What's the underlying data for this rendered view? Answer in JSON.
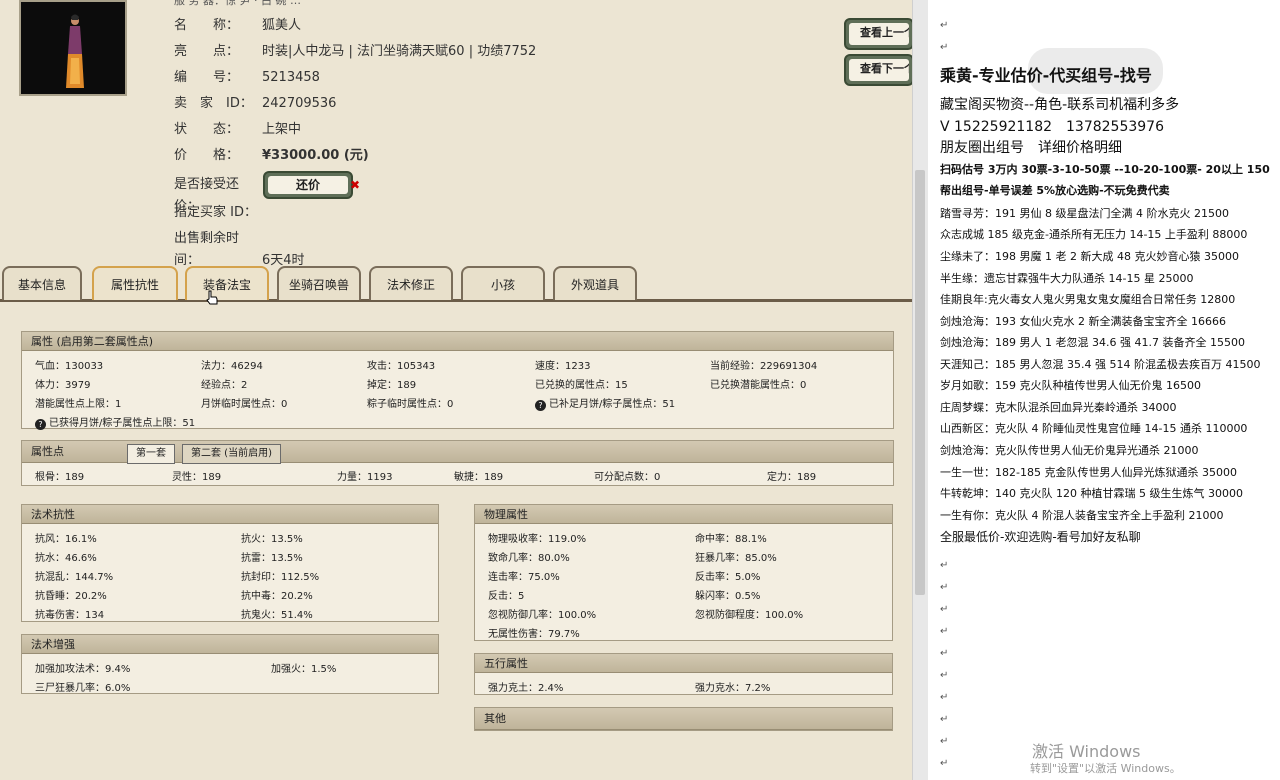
{
  "character": {
    "top_cut_text": "服 务 器：惊 尹 · 白 碗 …",
    "rows": [
      {
        "key": "名　　称：",
        "value": "狐美人"
      },
      {
        "key": "亮　　点：",
        "value": "时装|人中龙马 | 法门坐骑满天赋60 | 功绩7752"
      },
      {
        "key": "编　　号：",
        "value": "5213458"
      },
      {
        "key": "卖　家　ID：",
        "value": "242709536"
      },
      {
        "key": "状　　态：",
        "value": "上架中"
      },
      {
        "key": "价　　格：",
        "value": "¥33000.00 (元)"
      },
      {
        "key": "是否接受还价：",
        "value": ""
      },
      {
        "key": "指定买家 ID：",
        "value": ""
      },
      {
        "key": "出售剩余时间：",
        "value": "6天4时"
      }
    ],
    "bargain_label": "还价",
    "xmark": "✖"
  },
  "nav": {
    "prev_label": "查看上一个",
    "next_label": "查看下一个"
  },
  "tabs": [
    "基本信息",
    "属性抗性",
    "装备法宝",
    "坐骑召唤兽",
    "法术修正",
    "小孩",
    "外观道具"
  ],
  "attributes": {
    "title": "属性 (启用第二套属性点)",
    "rows": [
      [
        "气血：130033",
        "法力：46294",
        "攻击：105343",
        "速度：1233",
        "当前经验：229691304"
      ],
      [
        "体力：3979",
        "经验点：2",
        "掉定：189",
        "已兑换的属性点：15",
        "已兑换潜能属性点：0"
      ],
      [
        "潜能属性点上限：1",
        "月饼临时属性点：0",
        "粽子临时属性点：0",
        "已补足月饼/粽子属性点：51",
        ""
      ]
    ],
    "row3_q": "?",
    "row4": "已获得月饼/粽子属性点上限：51"
  },
  "points": {
    "title": "属性点",
    "tab1": "第一套",
    "tab2": "第二套 (当前启用)",
    "values": [
      "根骨：189",
      "灵性：189",
      "力量：1193",
      "敏捷：189",
      "可分配点数：0",
      "定力：189"
    ]
  },
  "resist": {
    "title": "法术抗性",
    "rows": [
      [
        "抗风：16.1%",
        "抗火：13.5%"
      ],
      [
        "抗水：46.6%",
        "抗雷：13.5%"
      ],
      [
        "抗混乱：144.7%",
        "抗封印：112.5%"
      ],
      [
        "抗昏睡：20.2%",
        "抗中毒：20.2%"
      ],
      [
        "抗毒伤害：134",
        "抗鬼火：51.4%"
      ]
    ]
  },
  "enhance": {
    "title": "法术增强",
    "rows": [
      [
        "加强加攻法术：9.4%",
        "加强火：1.5%"
      ],
      [
        "三尸狂暴几率：6.0%",
        ""
      ]
    ]
  },
  "physical": {
    "title": "物理属性",
    "rows": [
      [
        "物理吸收率：119.0%",
        "命中率：88.1%"
      ],
      [
        "致命几率：80.0%",
        "狂暴几率：85.0%"
      ],
      [
        "连击率：75.0%",
        "反击率：5.0%"
      ],
      [
        "反击：5",
        "躲闪率：0.5%"
      ],
      [
        "忽视防御几率：100.0%",
        "忽视防御程度：100.0%"
      ],
      [
        "无属性伤害：79.7%",
        ""
      ]
    ]
  },
  "wuxing": {
    "title": "五行属性",
    "rows": [
      [
        "强力克土：2.4%",
        "强力克水：7.2%"
      ]
    ]
  },
  "other": {
    "title": "其他"
  },
  "right": {
    "lines": [
      "乘黄-专业估价-代买组号-找号",
      "藏宝阁买物资--角色-联系司机福利多多",
      "V 15225921182　13782553976",
      "朋友圈出组号　详细价格明细",
      "扫码估号 3万内 30票-3-10-50票 --10-20-100票- 20以上 150",
      "帮出组号-单号误差 5%放心选购-不玩免费代卖",
      "踏雪寻芳：191 男仙 8 级星盘法门全满 4 阶水克火 21500",
      "众志成城 185 级克金-通杀所有无压力 14-15 上手盈利 88000",
      "尘缘未了：198 男魔 1 老 2 新大成 48 克火妙音心猿 35000",
      "半生缘：遗忘甘霖强牛大力队通杀 14-15 星 25000",
      "佳期良年:克火毒女人鬼火男鬼女鬼女魔组合日常任务 12800",
      "剑烛沧海：193 女仙火克水 2 新全满装备宝宝齐全 16666",
      "剑烛沧海：189 男人 1 老忽混 34.6 强 41.7 装备齐全 15500",
      "天涯知己：185 男人忽混 35.4 强 514 阶混孟极去疾百万 41500",
      "岁月如歌：159 克火队种植传世男人仙无价鬼 16500",
      "庄周梦蝶：克木队混杀回血异光秦岭通杀 34000",
      "山西新区：克火队 4 阶睡仙灵性鬼宫位睡 14-15 通杀 110000",
      "剑烛沧海：克火队传世男人仙无价鬼异光通杀 21000",
      "一生一世：182-185 克金队传世男人仙异光炼狱通杀 35000",
      "牛转乾坤：140 克火队 120 种植甘霖瑞 5 级生生炼气 30000",
      "一生有你：克火队 4 阶混人装备宝宝齐全上手盈利 21000",
      "全服最低价-欢迎选购-看号加好友私聊"
    ],
    "para_mark": "↵",
    "watermark_title": "激活 Windows",
    "watermark_sub": "转到\"设置\"以激活 Windows。"
  }
}
